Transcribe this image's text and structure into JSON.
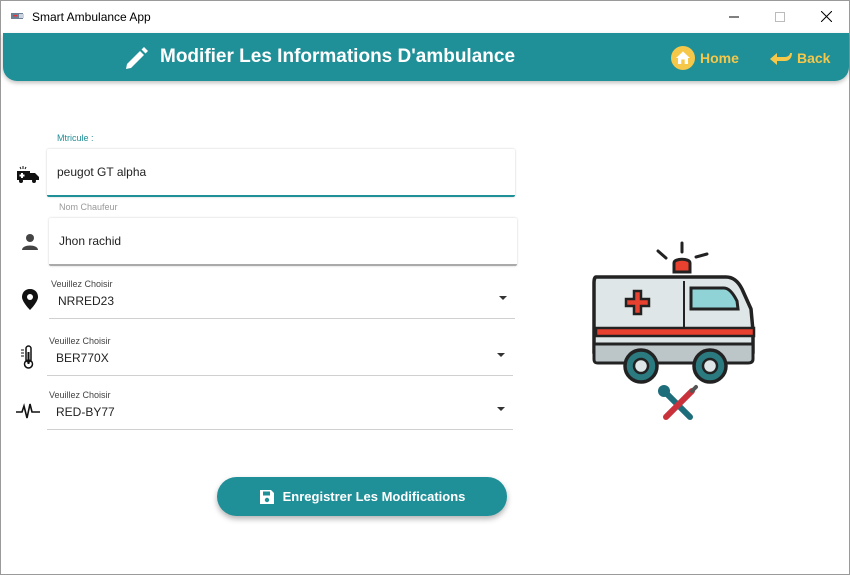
{
  "window": {
    "title": "Smart Ambulance App"
  },
  "header": {
    "title": "Modifier Les Informations D'ambulance",
    "home_label": "Home",
    "back_label": "Back"
  },
  "form": {
    "matricule": {
      "label": "Mtricule :",
      "value": "peugot GT alpha"
    },
    "chauffeur": {
      "label": "Nom Chaufeur",
      "value": "Jhon rachid"
    },
    "select1": {
      "label": "Veuillez Choisir",
      "value": "NRRED23"
    },
    "select2": {
      "label": "Veuillez Choisir",
      "value": "BER770X"
    },
    "select3": {
      "label": "Veuillez Choisir",
      "value": "RED-BY77"
    }
  },
  "save_button": {
    "label": "Enregistrer Les Modifications"
  },
  "colors": {
    "accent": "#1f8f98",
    "nav": "#f5c84a",
    "header_text": "#ffffff"
  },
  "icons": [
    "ambulance-icon",
    "person-icon",
    "location-pin-icon",
    "thermometer-icon",
    "heartbeat-icon",
    "pencil-icon",
    "home-icon",
    "back-arrow-icon",
    "save-icon",
    "ambulance-illustration",
    "wrench-screwdriver-icon"
  ]
}
